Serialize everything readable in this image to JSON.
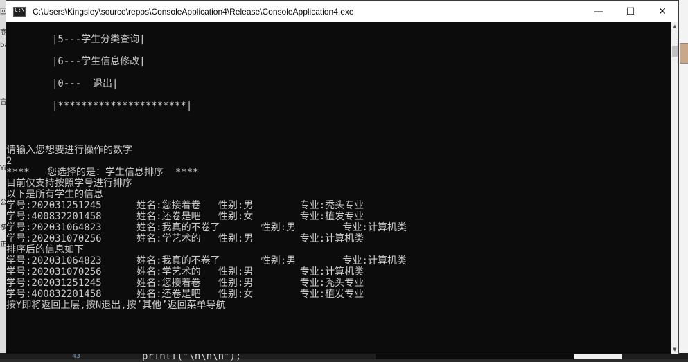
{
  "window": {
    "title": "C:\\Users\\Kingsley\\source\\repos\\ConsoleApplication4\\Release\\ConsoleApplication4.exe",
    "minimize_glyph": "—",
    "maximize_glyph": "☐",
    "close_glyph": "✕"
  },
  "console": {
    "menu": [
      "|5---学生分类查询|",
      "|6---学生信息修改|",
      "|0---  退出|",
      "|**********************|"
    ],
    "output": [
      "请输入您想要进行操作的数字",
      "2",
      "****   您选择的是：学生信息排序  ****",
      "目前仅支持按照学号进行排序",
      "以下是所有学生的信息",
      "学号:202031251245      姓名:您接着卷   性别:男        专业:秃头专业",
      "学号:400832201458      姓名:还卷是吧   性别:女        专业:植发专业",
      "学号:202031064823      姓名:我真的不卷了       性别:男        专业:计算机类",
      "学号:202031070256      姓名:学艺术的   性别:男        专业:计算机类",
      "排序后的信息如下",
      "学号:202031064823      姓名:我真的不卷了       性别:男        专业:计算机类",
      "学号:202031070256      姓名:学艺术的   性别:男        专业:计算机类",
      "学号:202031251245      姓名:您接着卷   性别:男        专业:秃头专业",
      "学号:400832201458      姓名:还卷是吧   性别:女        专业:植发专业",
      "按Y即将返回上层,按N退出,按’其他’返回菜单导航"
    ]
  },
  "background": {
    "line_number": "43",
    "code_snippet": "printf(\"\\n\\n\\n\");"
  },
  "colors": {
    "console_bg": "#0c0c0c",
    "console_text": "#cccccc",
    "titlebar_bg": "#ffffff"
  }
}
